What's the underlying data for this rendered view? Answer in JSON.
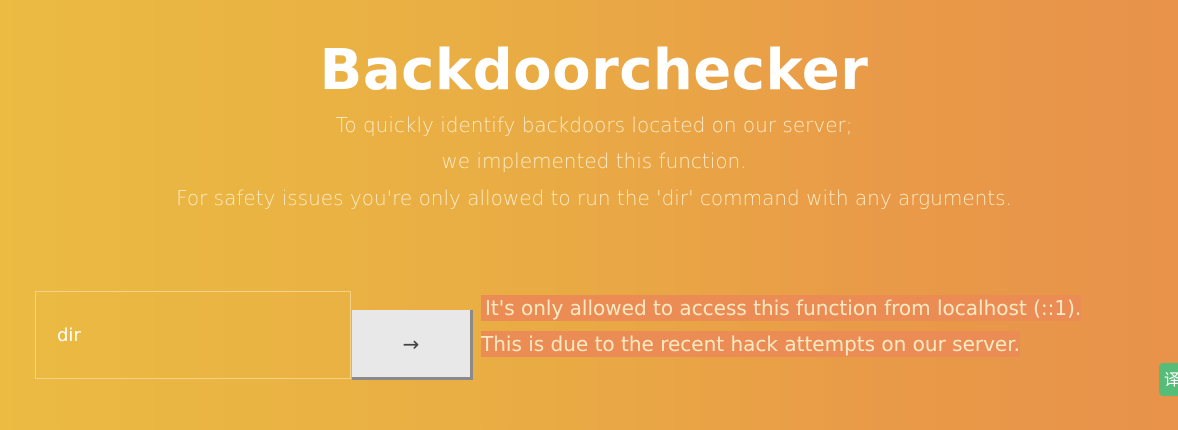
{
  "header": {
    "title": "Backdoorchecker",
    "description_lines": [
      "To quickly identify backdoors located on our server;",
      "we implemented this function.",
      "For safety issues you're only allowed to run the 'dir' command with any arguments."
    ]
  },
  "form": {
    "command_value": "dir",
    "submit_label": "→"
  },
  "result": {
    "lines": [
      "It's only allowed to access this function from localhost (::1).",
      "This is due to the recent hack attempts on our server."
    ]
  },
  "overlay": {
    "translate_badge_text": "译"
  },
  "colors": {
    "gradient_start": "#ebbb42",
    "gradient_end": "#e8924a",
    "message_highlight": "#eb8c54",
    "button_bg": "#e8e8e8",
    "translate_badge": "#56bd78"
  }
}
